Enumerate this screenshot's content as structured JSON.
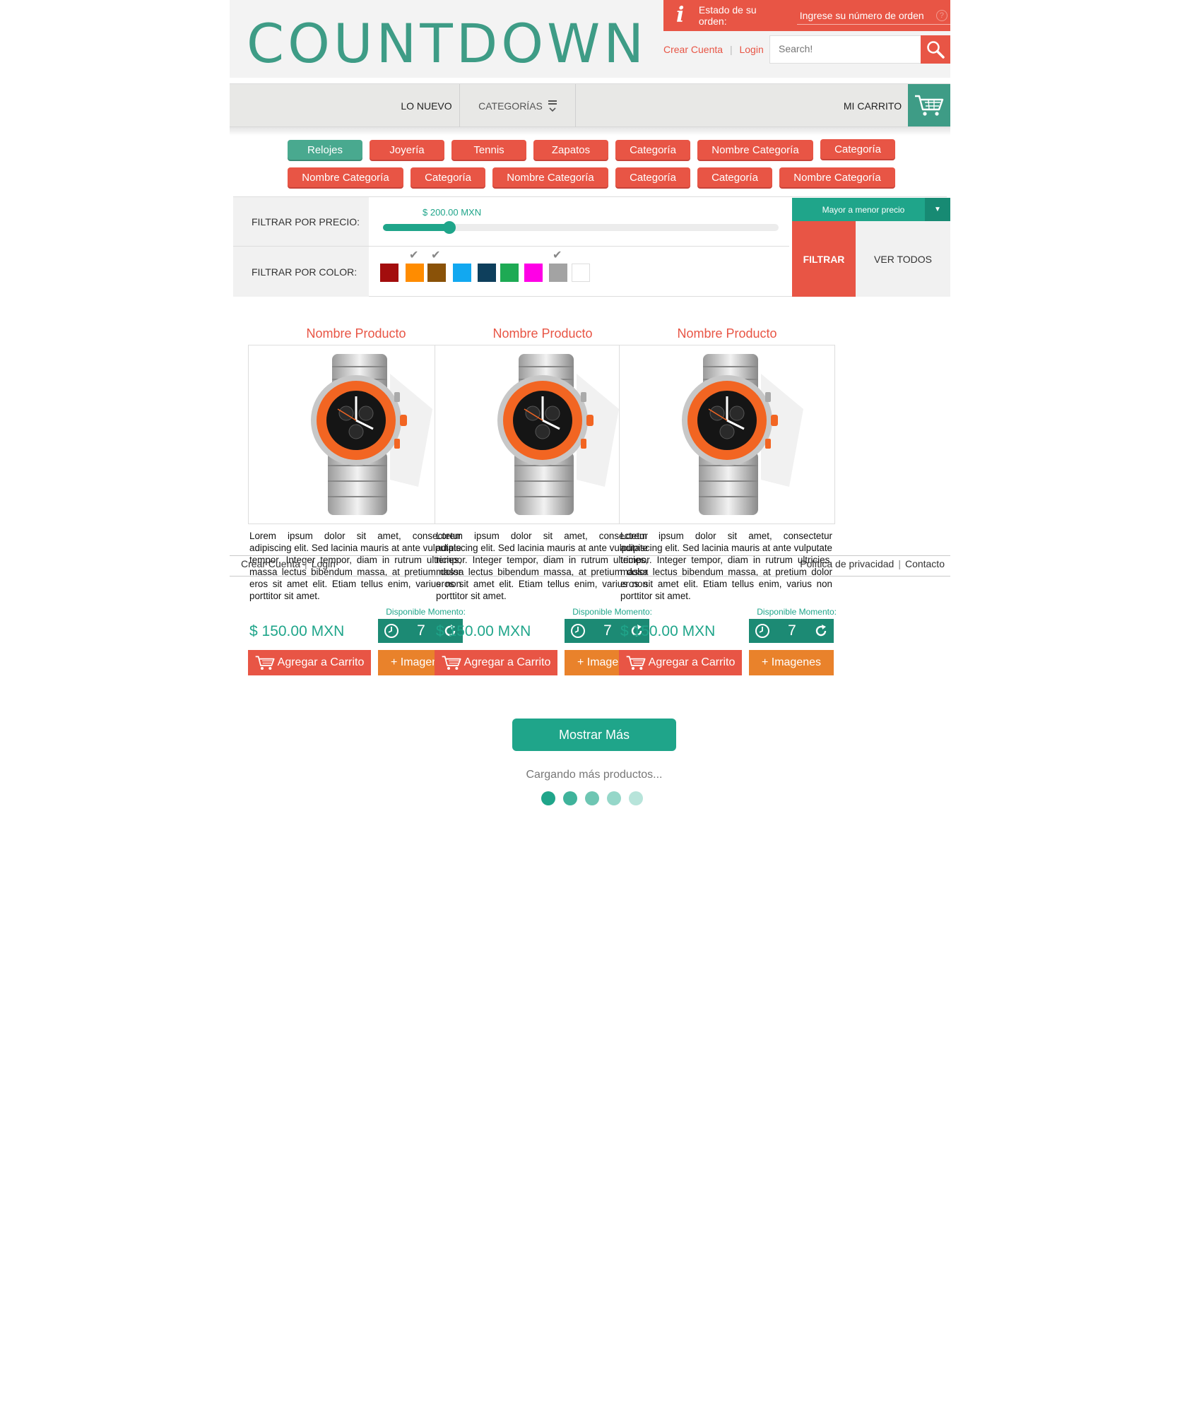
{
  "header": {
    "logo": "COUNTDOWN",
    "order_status_label": "Estado de su orden:",
    "order_input_placeholder": "Ingrese su número de orden",
    "help_glyph": "?",
    "create_account": "Crear Cuenta",
    "separator": "|",
    "login": "Login",
    "search_placeholder": "Search!"
  },
  "nav": {
    "new": "LO NUEVO",
    "categories": "CATEGORÍAS",
    "cart": "MI CARRITO"
  },
  "categories": [
    "Relojes",
    "Joyería",
    "Tennis",
    "Zapatos",
    "Categoría",
    "Nombre Categoría",
    "Categoría",
    "Nombre Categoría",
    "Categoría",
    "Nombre Categoría",
    "Categoría",
    "Categoría",
    "Nombre Categoría"
  ],
  "active_category": "Relojes",
  "filters": {
    "price_label": "FILTRAR POR PRECIO:",
    "price_value": "$ 200.00 MXN",
    "price_fraction": 0.2,
    "color_label": "FILTRAR POR COLOR:",
    "colors": [
      {
        "name": "dark-red",
        "hex": "#a30d0d",
        "checked": false
      },
      {
        "name": "orange",
        "hex": "#ff8c00",
        "checked": true
      },
      {
        "name": "brown",
        "hex": "#8a5208",
        "checked": true
      },
      {
        "name": "sky-blue",
        "hex": "#12a8f0",
        "checked": false
      },
      {
        "name": "navy",
        "hex": "#0e3f5c",
        "checked": false
      },
      {
        "name": "green",
        "hex": "#1eaa54",
        "checked": false
      },
      {
        "name": "magenta",
        "hex": "#ff00e6",
        "checked": false
      },
      {
        "name": "gray",
        "hex": "#a3a3a3",
        "checked": true
      },
      {
        "name": "white",
        "hex": "#ffffff",
        "checked": false
      }
    ],
    "sort": "Mayor a menor precio",
    "filter_button": "FILTRAR",
    "view_all_button": "VER TODOS"
  },
  "products": [
    {
      "name": "Nombre Producto",
      "description": "Lorem ipsum dolor sit amet, consectetur adipiscing elit. Sed lacinia mauris at ante vulputate tempor. Integer tempor, diam in rutrum ultricies, massa lectus bibendum massa, at pretium dolor eros sit amet elit. Etiam tellus enim, varius non porttitor sit amet.",
      "availability": "Disponible Momento:",
      "price": "$ 150.00 MXN",
      "count": "7",
      "add_to_cart": "Agregar a Carrito",
      "images": "+ Imagenes"
    },
    {
      "name": "Nombre Producto",
      "description": "Lorem ipsum dolor sit amet, consectetur adipiscing elit. Sed lacinia mauris at ante vulputate tempor. Integer tempor, diam in rutrum ultricies, massa lectus bibendum massa, at pretium dolor eros sit amet elit. Etiam tellus enim, varius non porttitor sit amet.",
      "availability": "Disponible Momento:",
      "price": "$ 150.00 MXN",
      "count": "7",
      "add_to_cart": "Agregar a Carrito",
      "images": "+ Imagenes"
    },
    {
      "name": "Nombre Producto",
      "description": "Lorem ipsum dolor sit amet, consectetur adipiscing elit. Sed lacinia mauris at ante vulputate tempor. Integer tempor, diam in rutrum ultricies, massa lectus bibendum massa, at pretium dolor eros sit amet elit. Etiam tellus enim, varius non porttitor sit amet.",
      "availability": "Disponible Momento:",
      "price": "$ 150.00 MXN",
      "count": "7",
      "add_to_cart": "Agregar a Carrito",
      "images": "+ Imagenes"
    }
  ],
  "footer": {
    "create_account": "Crear Cuenta",
    "login": "Login",
    "separator": "|",
    "privacy": "Política de privacidad",
    "contact": "Contacto"
  },
  "load_more": {
    "button": "Mostrar Más",
    "loading_text": "Cargando más productos...",
    "dot_colors": [
      "#1fa58a",
      "#3fb39b",
      "#6ec6b3",
      "#95d7c9",
      "#b7e4da"
    ]
  },
  "colors": {
    "brand_teal": "#3e9c86",
    "accent_red": "#e85545",
    "accent_orange": "#e9822b",
    "accent_green": "#1fa58a"
  }
}
